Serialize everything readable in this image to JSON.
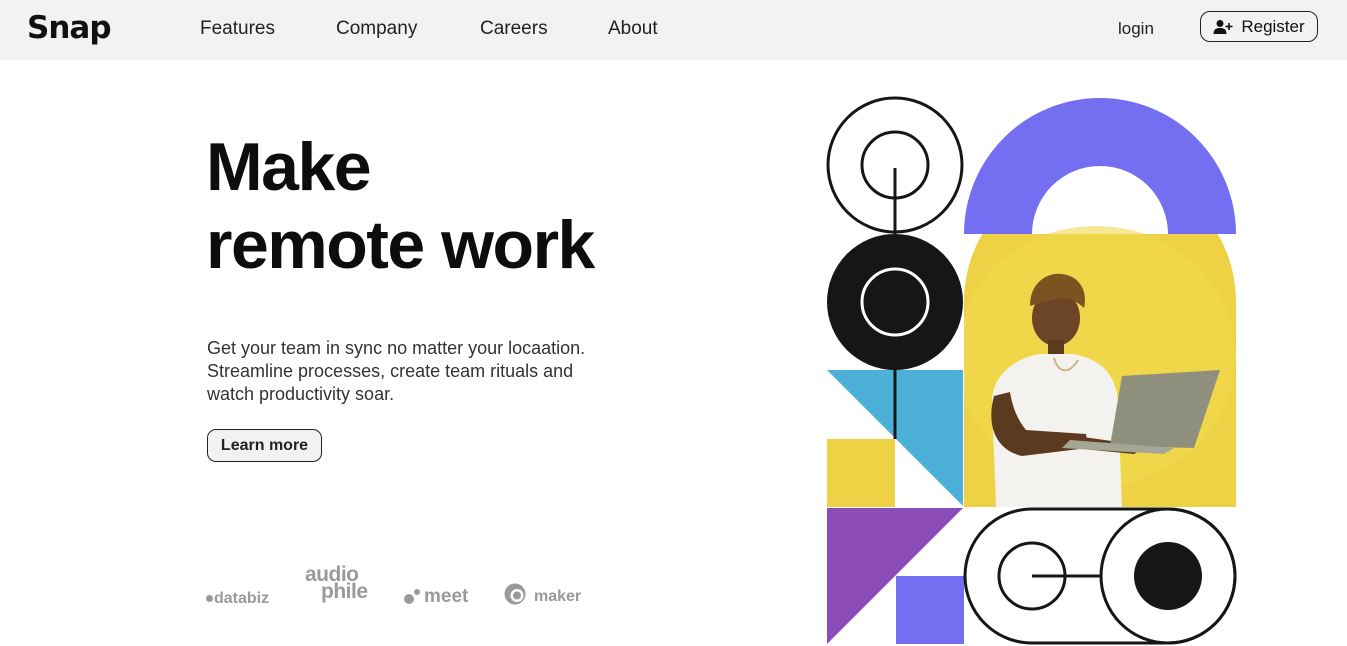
{
  "brand": {
    "logo": "Snap"
  },
  "nav": {
    "links": [
      "Features",
      "Company",
      "Careers",
      "About"
    ],
    "login": "login",
    "register": "Register"
  },
  "hero": {
    "headline_line1": "Make",
    "headline_line2": "remote work",
    "subtext": "Get your team in sync no matter your locaation. Streamline processes, create team rituals and watch productivity soar.",
    "cta": "Learn more"
  },
  "clients": {
    "databiz": "databiz",
    "audiophile_line1": "audio",
    "audiophile_line2": "phile",
    "meet": "meet",
    "maker": "maker"
  },
  "colors": {
    "purple": "#746ef0",
    "yellow": "#efd145",
    "blue": "#4cb0d9",
    "violet": "#8c4db8",
    "dark": "#161616"
  }
}
